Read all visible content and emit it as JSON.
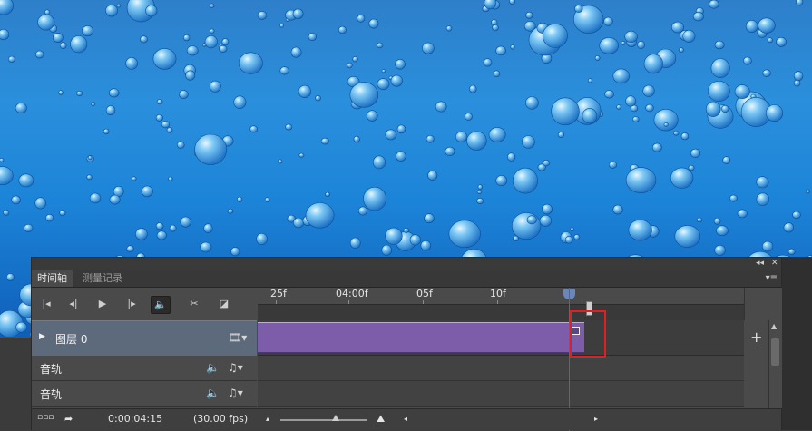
{
  "panel": {
    "collapse_glyph": "◂◂",
    "close_glyph": "✕",
    "tabs": [
      {
        "label": "时间轴",
        "active": true
      },
      {
        "label": "测量记录",
        "active": false
      }
    ],
    "menu_icon_glyph": "▾≡"
  },
  "controls": [
    {
      "name": "go-to-first-frame-icon",
      "glyph": "|◂"
    },
    {
      "name": "previous-frame-icon",
      "glyph": "◂|"
    },
    {
      "name": "play-icon",
      "glyph": "▶"
    },
    {
      "name": "next-frame-icon",
      "glyph": "|▸"
    },
    {
      "name": "audio-toggle-icon",
      "glyph": "🔈",
      "active": true
    },
    {
      "name": "split-at-playhead-icon",
      "glyph": "✂"
    },
    {
      "name": "transition-icon",
      "glyph": "◪"
    }
  ],
  "ruler": {
    "ticks": [
      "25f",
      "04:00f",
      "05f",
      "10f"
    ]
  },
  "tracks": [
    {
      "label": "图层 0",
      "type": "video",
      "expand_glyph": "▶",
      "menu_glyph": "🎞▾"
    },
    {
      "label": "音轨",
      "type": "audio",
      "volume_glyph": "🔈",
      "music_glyph": "♫▾"
    },
    {
      "label": "音轨",
      "type": "audio",
      "volume_glyph": "🔈",
      "music_glyph": "♫▾"
    }
  ],
  "add_track_glyph": "+",
  "footer": {
    "render_glyph": "▫▫▫",
    "convert_glyph": "➦",
    "timecode": "0:00:04:15",
    "fps": "(30.00 fps)",
    "zoom_out_glyph": "▴",
    "zoom_in_glyph": "⛰"
  },
  "colors": {
    "clip": "#7d5daa",
    "playhead": "#dd3333",
    "highlight": "#e02020"
  }
}
